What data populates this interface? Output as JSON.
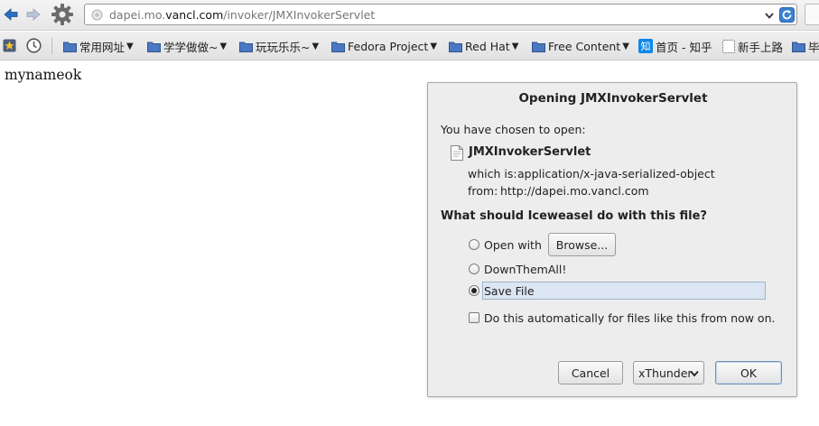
{
  "browser": {
    "url": {
      "prefix": "dapei.mo.",
      "domain": "vancl.com",
      "path": "/invoker/JMXInvokerServlet"
    },
    "icons": [
      "back-arrow-icon",
      "forward-arrow-icon",
      "gear-icon",
      "site-identity-icon",
      "dropdown-arrow-icon",
      "reload-icon"
    ]
  },
  "bookmarks": {
    "items": [
      {
        "label": "常用网址",
        "has_menu": true
      },
      {
        "label": "学学做做~",
        "has_menu": true
      },
      {
        "label": "玩玩乐乐~",
        "has_menu": true
      },
      {
        "label": "Fedora Project",
        "has_menu": true
      },
      {
        "label": "Red Hat",
        "has_menu": true
      },
      {
        "label": "Free Content",
        "has_menu": true
      },
      {
        "label": "首页 - 知乎",
        "has_menu": false
      },
      {
        "label": "新手上路",
        "has_menu": false
      },
      {
        "label": "毕",
        "has_menu": false
      }
    ],
    "zhihu_icon_text": "知"
  },
  "page": {
    "body_text": "mynameok"
  },
  "dialog": {
    "title": "Opening JMXInvokerServlet",
    "intro": "You have chosen to open:",
    "filename": "JMXInvokerServlet",
    "which_is_label": "which is:",
    "which_is_value": "application/x-java-serialized-object",
    "from_label": "from:",
    "from_value": "http://dapei.mo.vancl.com",
    "question": "What should Iceweasel do with this file?",
    "options": {
      "open_with": "Open with",
      "browse": "Browse...",
      "downthemall": "DownThemAll!",
      "save_file": "Save File",
      "selected": "Save File"
    },
    "auto_checkbox": "Do this automatically for files like this from now on.",
    "auto_checked": false,
    "buttons": {
      "cancel": "Cancel",
      "downloader": "xThunder",
      "ok": "OK"
    }
  },
  "colors": {
    "nav_arrow": "#2c6fc0",
    "folder": "#4a78c2",
    "zhihu": "#0f88eb",
    "selection": "#dbe6f2"
  }
}
